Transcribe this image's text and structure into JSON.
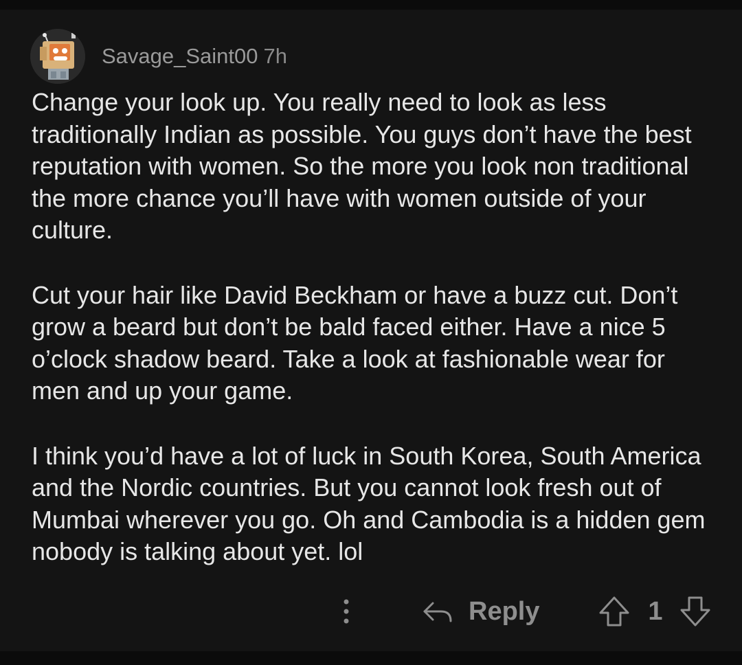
{
  "comment": {
    "username": "Savage_Saint00",
    "time": "7h",
    "avatar_icon": "robot-avatar-icon",
    "paragraphs": [
      "Change your look up. You really need to look as less traditionally Indian as possible. You guys don’t have the best reputation with women. So the more you look non traditional the more chance you’ll have with women outside of your culture.",
      "Cut your hair like David Beckham or have a buzz cut. Don’t grow a beard but don’t be bald faced either. Have a nice 5 o’clock shadow beard. Take a look at fashionable wear for men and up your game.",
      "I think you’d have a lot of luck in South Korea, South America and the Nordic countries. But you cannot look fresh out of Mumbai wherever you go. Oh and Cambodia is a hidden gem nobody is talking about yet. lol"
    ]
  },
  "actions": {
    "more_icon": "more-vertical-icon",
    "reply_icon": "reply-arrow-icon",
    "reply_label": "Reply",
    "upvote_icon": "upvote-arrow-icon",
    "score": "1",
    "downvote_icon": "downvote-arrow-icon"
  },
  "colors": {
    "background": "#141414",
    "text": "#e7e7e7",
    "muted": "#8e8e8e"
  }
}
